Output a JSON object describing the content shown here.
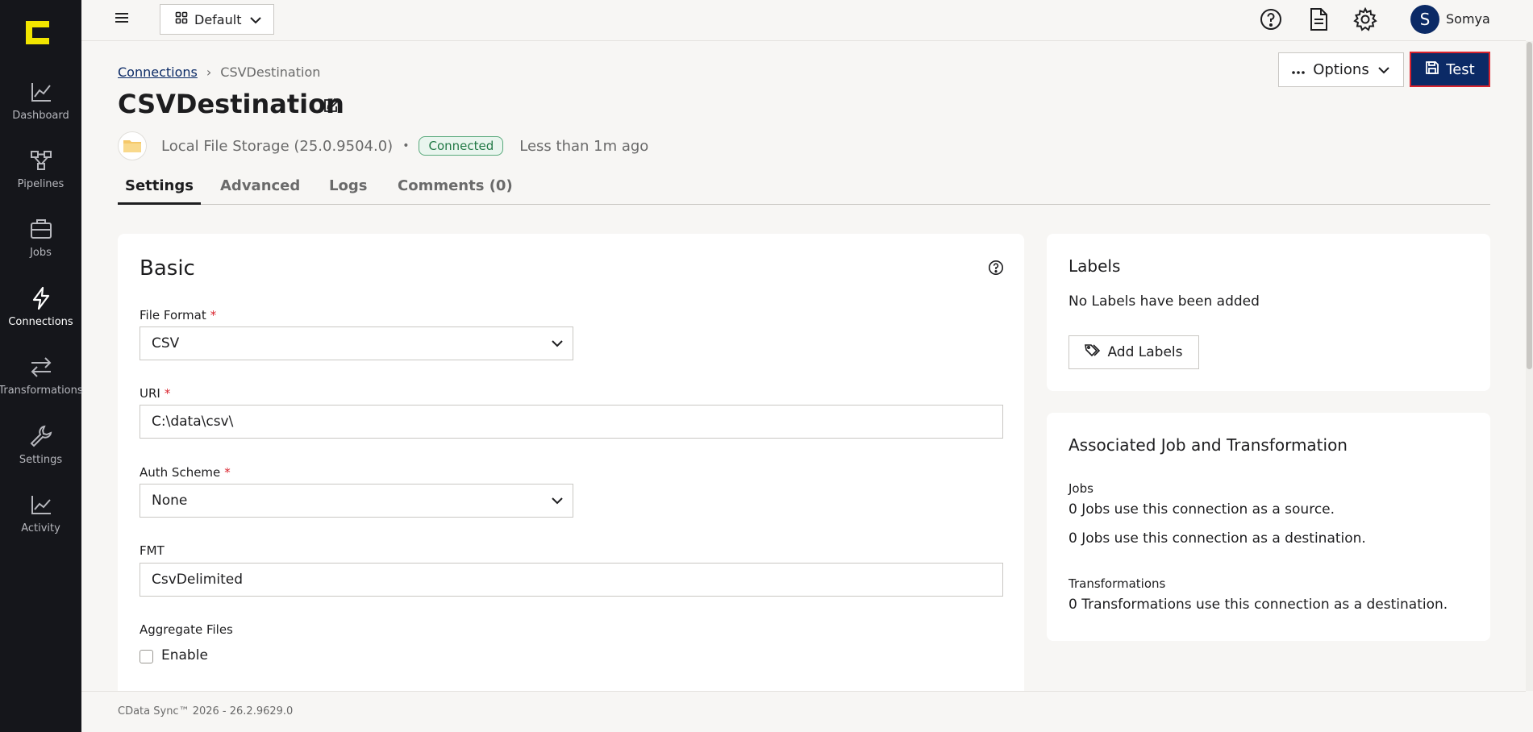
{
  "sidebar": {
    "items": [
      {
        "label": "Dashboard",
        "icon": "chart-line-icon"
      },
      {
        "label": "Pipelines",
        "icon": "pipeline-icon"
      },
      {
        "label": "Jobs",
        "icon": "briefcase-icon"
      },
      {
        "label": "Connections",
        "icon": "lightning-icon"
      },
      {
        "label": "Transformations",
        "icon": "arrows-swap-icon"
      },
      {
        "label": "Settings",
        "icon": "wrench-icon"
      },
      {
        "label": "Activity",
        "icon": "activity-chart-icon"
      }
    ],
    "active": "Connections"
  },
  "topbar": {
    "workspace_label": "Default",
    "user_initial": "S",
    "user_name": "Somya"
  },
  "header": {
    "breadcrumb_root": "Connections",
    "breadcrumb_sep": "›",
    "breadcrumb_current": "CSVDestination",
    "title": "CSVDestination",
    "options_label": "Options",
    "test_label": "Test"
  },
  "connection": {
    "provider": "Local File Storage (25.0.9504.0)",
    "dot": "•",
    "status": "Connected",
    "updated": "Less than 1m ago"
  },
  "tabs": [
    {
      "label": "Settings"
    },
    {
      "label": "Advanced"
    },
    {
      "label": "Logs"
    },
    {
      "label": "Comments (0)"
    }
  ],
  "basic": {
    "title": "Basic",
    "file_format_label": "File Format",
    "file_format_value": "CSV",
    "uri_label": "URI",
    "uri_value": "C:\\data\\csv\\",
    "auth_label": "Auth Scheme",
    "auth_value": "None",
    "fmt_label": "FMT",
    "fmt_value": "CsvDelimited",
    "aggregate_label": "Aggregate Files",
    "enable_label": "Enable",
    "required_mark": "*"
  },
  "labels": {
    "title": "Labels",
    "empty_text": "No Labels have been added",
    "add_button": "Add Labels"
  },
  "associated": {
    "title": "Associated Job and Transformation",
    "jobs_heading": "Jobs",
    "jobs_source": "0 Jobs use this connection as a source.",
    "jobs_destination": "0 Jobs use this connection as a destination.",
    "transformations_heading": "Transformations",
    "transformations_destination": "0 Transformations use this connection as a destination."
  },
  "footer": {
    "text": "CData Sync™ 2026 - 26.2.9629.0"
  },
  "colors": {
    "sidebar_bg": "#15161b",
    "brand_yellow": "#f2e500",
    "primary_navy": "#0b2a66",
    "status_green": "#237a47",
    "required_red": "#d9232d"
  }
}
